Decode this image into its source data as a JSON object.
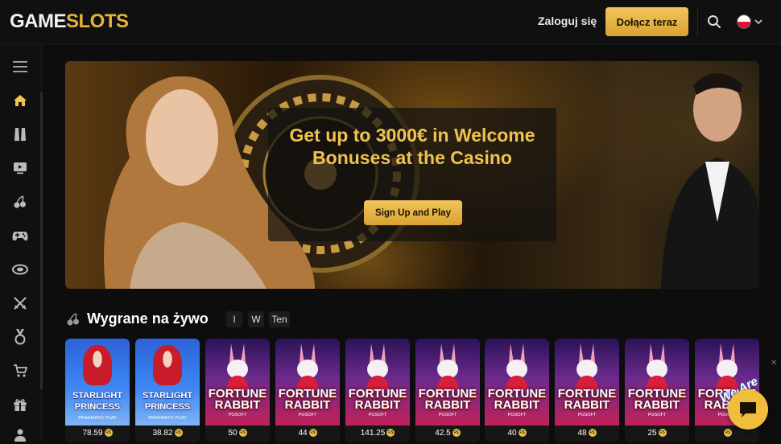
{
  "header": {
    "logo_left": "GAME",
    "logo_right": "SLOTS",
    "login_label": "Zaloguj się",
    "join_label": "Dołącz teraz",
    "search_icon": "search-icon",
    "language_flag": "poland-flag-icon"
  },
  "sidebar": {
    "items": [
      {
        "icon": "menu-icon"
      },
      {
        "icon": "home-icon"
      },
      {
        "icon": "tuxedo-icon"
      },
      {
        "icon": "tv-play-icon"
      },
      {
        "icon": "cherries-icon"
      },
      {
        "icon": "gamepad-icon"
      },
      {
        "icon": "chips-icon"
      },
      {
        "icon": "crossed-swords-icon"
      },
      {
        "icon": "medal-icon"
      },
      {
        "icon": "cart-icon"
      },
      {
        "icon": "gift-icon"
      },
      {
        "icon": "users-icon"
      }
    ]
  },
  "banner": {
    "headline": "Get up to 3000€ in Welcome Bonuses at the Casino",
    "cta_label": "Sign Up and Play"
  },
  "live_wins": {
    "title": "Wygrane na żywo",
    "filters": [
      "I",
      "W",
      "Ten"
    ],
    "cards": [
      {
        "game": "STARLIGHT PRINCESS",
        "provider": "PRAGMATIC PLAY",
        "amount": "78.59",
        "currency": "R$",
        "theme": "starlight"
      },
      {
        "game": "STARLIGHT PRINCESS",
        "provider": "PRAGMATIC PLAY",
        "amount": "38.82",
        "currency": "R$",
        "theme": "starlight"
      },
      {
        "game": "FORTUNE RABBIT",
        "provider": "PGSOFT",
        "amount": "50",
        "currency": "R$",
        "theme": "rabbit"
      },
      {
        "game": "FORTUNE RABBIT",
        "provider": "PGSOFT",
        "amount": "44",
        "currency": "R$",
        "theme": "rabbit"
      },
      {
        "game": "FORTUNE RABBIT",
        "provider": "PGSOFT",
        "amount": "141.25",
        "currency": "R$",
        "theme": "rabbit"
      },
      {
        "game": "FORTUNE RABBIT",
        "provider": "PGSOFT",
        "amount": "42.5",
        "currency": "R$",
        "theme": "rabbit"
      },
      {
        "game": "FORTUNE RABBIT",
        "provider": "PGSOFT",
        "amount": "40",
        "currency": "R$",
        "theme": "rabbit"
      },
      {
        "game": "FORTUNE RABBIT",
        "provider": "PGSOFT",
        "amount": "48",
        "currency": "R$",
        "theme": "rabbit"
      },
      {
        "game": "FORTUNE RABBIT",
        "provider": "PGSOFT",
        "amount": "25",
        "currency": "R$",
        "theme": "rabbit"
      },
      {
        "game": "FORTUNE RABBIT",
        "provider": "PGSOFT",
        "amount": "",
        "currency": "R$",
        "theme": "rabbit"
      }
    ]
  },
  "chat": {
    "badge_text": "We Are Here!",
    "close_label": "✕"
  },
  "colors": {
    "accent_gold": "#e8b23a",
    "background": "#0d0d0d"
  }
}
